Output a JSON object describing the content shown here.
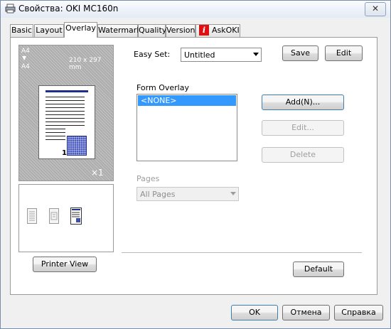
{
  "window": {
    "title": "Свойства: OKI MC160n",
    "close_label": "✕"
  },
  "tabs": [
    "Basic",
    "Layout",
    "Overlay",
    "Watermark",
    "Quality",
    "Version",
    "AskOKI"
  ],
  "preview": {
    "paper_top": "A4",
    "arrow": "▼",
    "paper_bottom": "A4",
    "size": "210 x 297 mm",
    "copies": "×1",
    "printer_view_label": "Printer View"
  },
  "easy_set": {
    "label": "Easy Set:",
    "value": "Untitled",
    "save_label": "Save",
    "edit_label": "Edit"
  },
  "form_overlay": {
    "label": "Form Overlay",
    "items": [
      "<NONE>"
    ],
    "add_label": "Add(N)...",
    "edit_label": "Edit...",
    "delete_label": "Delete"
  },
  "pages": {
    "label": "Pages",
    "value": "All Pages"
  },
  "default_label": "Default",
  "footer": {
    "ok_label": "OK",
    "cancel_label": "Отмена",
    "help_label": "Справка"
  },
  "colors": {
    "selection": "#3399ff",
    "preview_bg": "#adadad",
    "overlay_blue": "#3d4fa8",
    "page_header": "#1e2f8c"
  },
  "icons": [
    "printer-icon",
    "close-icon",
    "info-icon",
    "dropdown-arrow-icon",
    "document-thumb-icon"
  ]
}
